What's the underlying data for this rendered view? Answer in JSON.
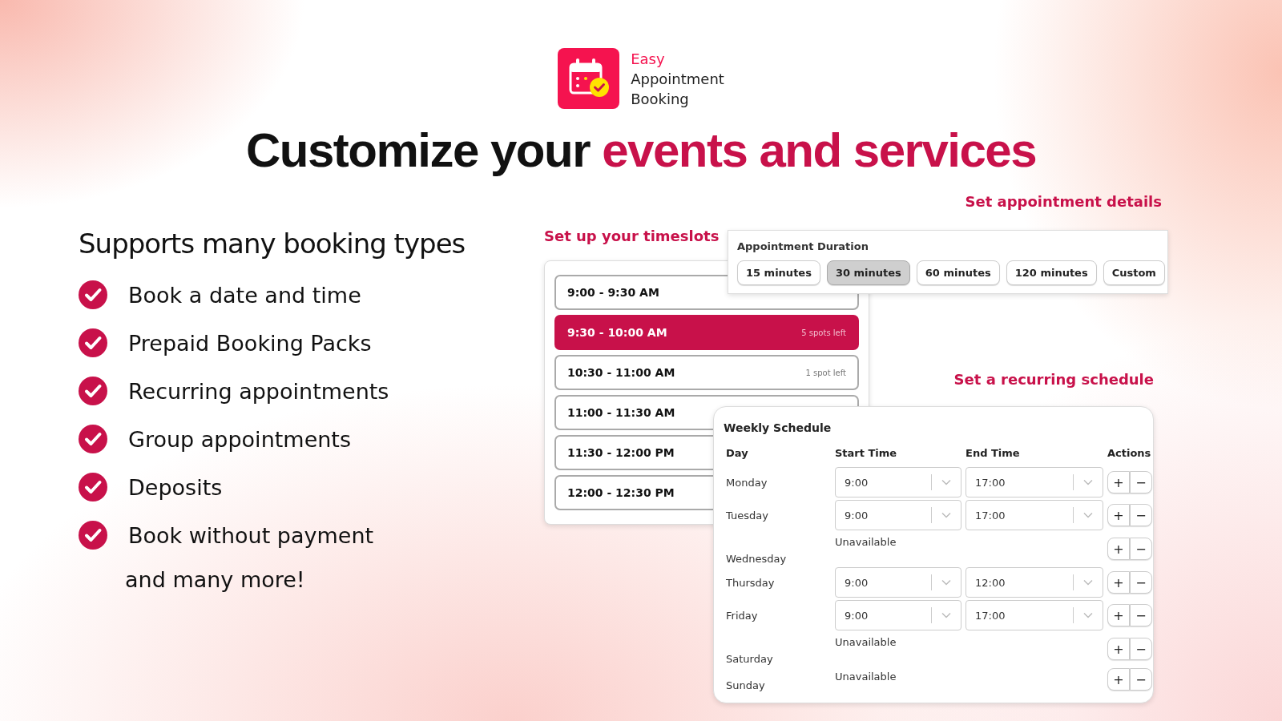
{
  "logo": {
    "name_accent": "Easy",
    "name_lines": [
      "Appointment",
      "Booking"
    ]
  },
  "headline": {
    "plain": "Customize your",
    "accent": "events and services"
  },
  "features": {
    "title": "Supports many booking types",
    "items": [
      "Book a date and time",
      "Prepaid Booking Packs",
      "Recurring appointments",
      "Group appointments",
      "Deposits",
      "Book without payment"
    ],
    "footer": "and many more!"
  },
  "timeslots": {
    "caption": "Set up your timeslots",
    "slots": [
      {
        "label": "9:00 - 9:30 AM",
        "selected": false
      },
      {
        "label": "9:30 - 10:00 AM",
        "spots": "5 spots left",
        "selected": true
      },
      {
        "label": "10:30 - 11:00 AM",
        "spots": "1 spot left",
        "selected": false
      },
      {
        "label": "11:00 - 11:30 AM",
        "selected": false
      },
      {
        "label": "11:30 - 12:00 PM",
        "selected": false
      },
      {
        "label": "12:00 - 12:30 PM",
        "selected": false
      }
    ]
  },
  "details": {
    "caption": "Set appointment details",
    "title": "Appointment Duration",
    "options": [
      {
        "label": "15 minutes",
        "selected": false
      },
      {
        "label": "30 minutes",
        "selected": true
      },
      {
        "label": "60 minutes",
        "selected": false
      },
      {
        "label": "120 minutes",
        "selected": false
      },
      {
        "label": "Custom",
        "selected": false
      }
    ]
  },
  "schedule": {
    "caption": "Set a recurring schedule",
    "title": "Weekly Schedule",
    "columns": [
      "Day",
      "Start Time",
      "End Time",
      "Actions"
    ],
    "add": "+",
    "remove": "−",
    "rows": [
      {
        "day": "Monday",
        "kind": "times",
        "start": "9:00",
        "end": "17:00"
      },
      {
        "day": "Tuesday",
        "kind": "times",
        "start": "9:00",
        "end": "17:00"
      },
      {
        "day": "Wednesday",
        "kind": "unavailable",
        "status": "Unavailable"
      },
      {
        "day": "Thursday",
        "kind": "times",
        "start": "9:00",
        "end": "12:00"
      },
      {
        "day": "Friday",
        "kind": "times",
        "start": "9:00",
        "end": "17:00"
      },
      {
        "day": "Saturday",
        "kind": "unavailable",
        "status": "Unavailable"
      },
      {
        "day": "Sunday",
        "kind": "unavailable",
        "status": "Unavailable"
      }
    ]
  }
}
